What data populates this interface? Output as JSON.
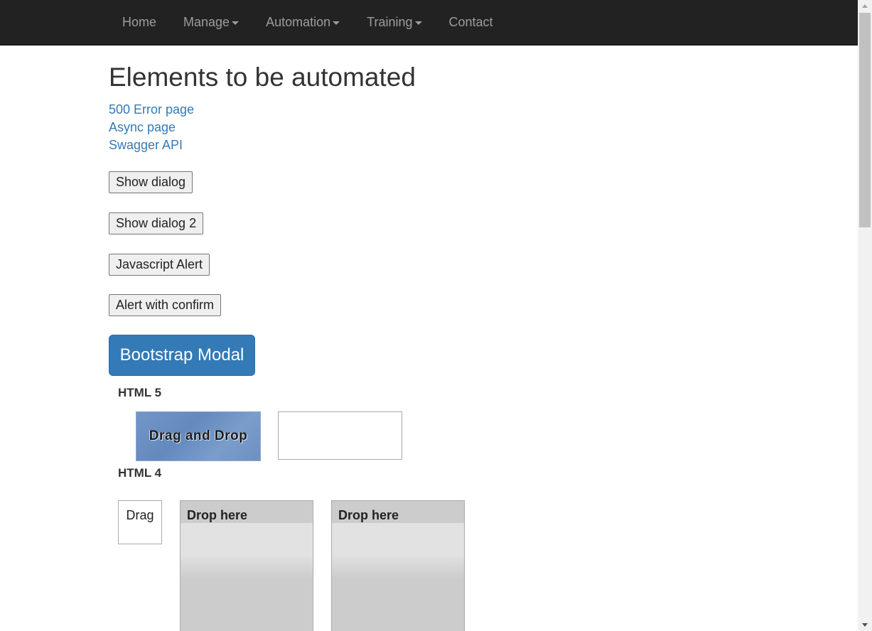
{
  "nav": {
    "items": [
      {
        "label": "Home",
        "dropdown": false
      },
      {
        "label": "Manage",
        "dropdown": true
      },
      {
        "label": "Automation",
        "dropdown": true
      },
      {
        "label": "Training",
        "dropdown": true
      },
      {
        "label": "Contact",
        "dropdown": false
      }
    ]
  },
  "main": {
    "title": "Elements to be automated",
    "links": [
      "500 Error page",
      "Async page",
      "Swagger API"
    ],
    "buttons": {
      "show_dialog": "Show dialog",
      "show_dialog_2": "Show dialog 2",
      "js_alert": "Javascript Alert",
      "alert_confirm": "Alert with confirm",
      "bootstrap_modal": "Bootstrap Modal"
    },
    "html5": {
      "label": "HTML 5",
      "drag_source": "Drag and Drop"
    },
    "html4": {
      "label": "HTML 4",
      "drag": "Drag",
      "drop_1": "Drop here",
      "drop_2": "Drop here"
    }
  },
  "colors": {
    "navbar_bg": "#222222",
    "nav_text": "#9d9d9d",
    "link": "#337ab7",
    "primary_button": "#337ab7"
  }
}
